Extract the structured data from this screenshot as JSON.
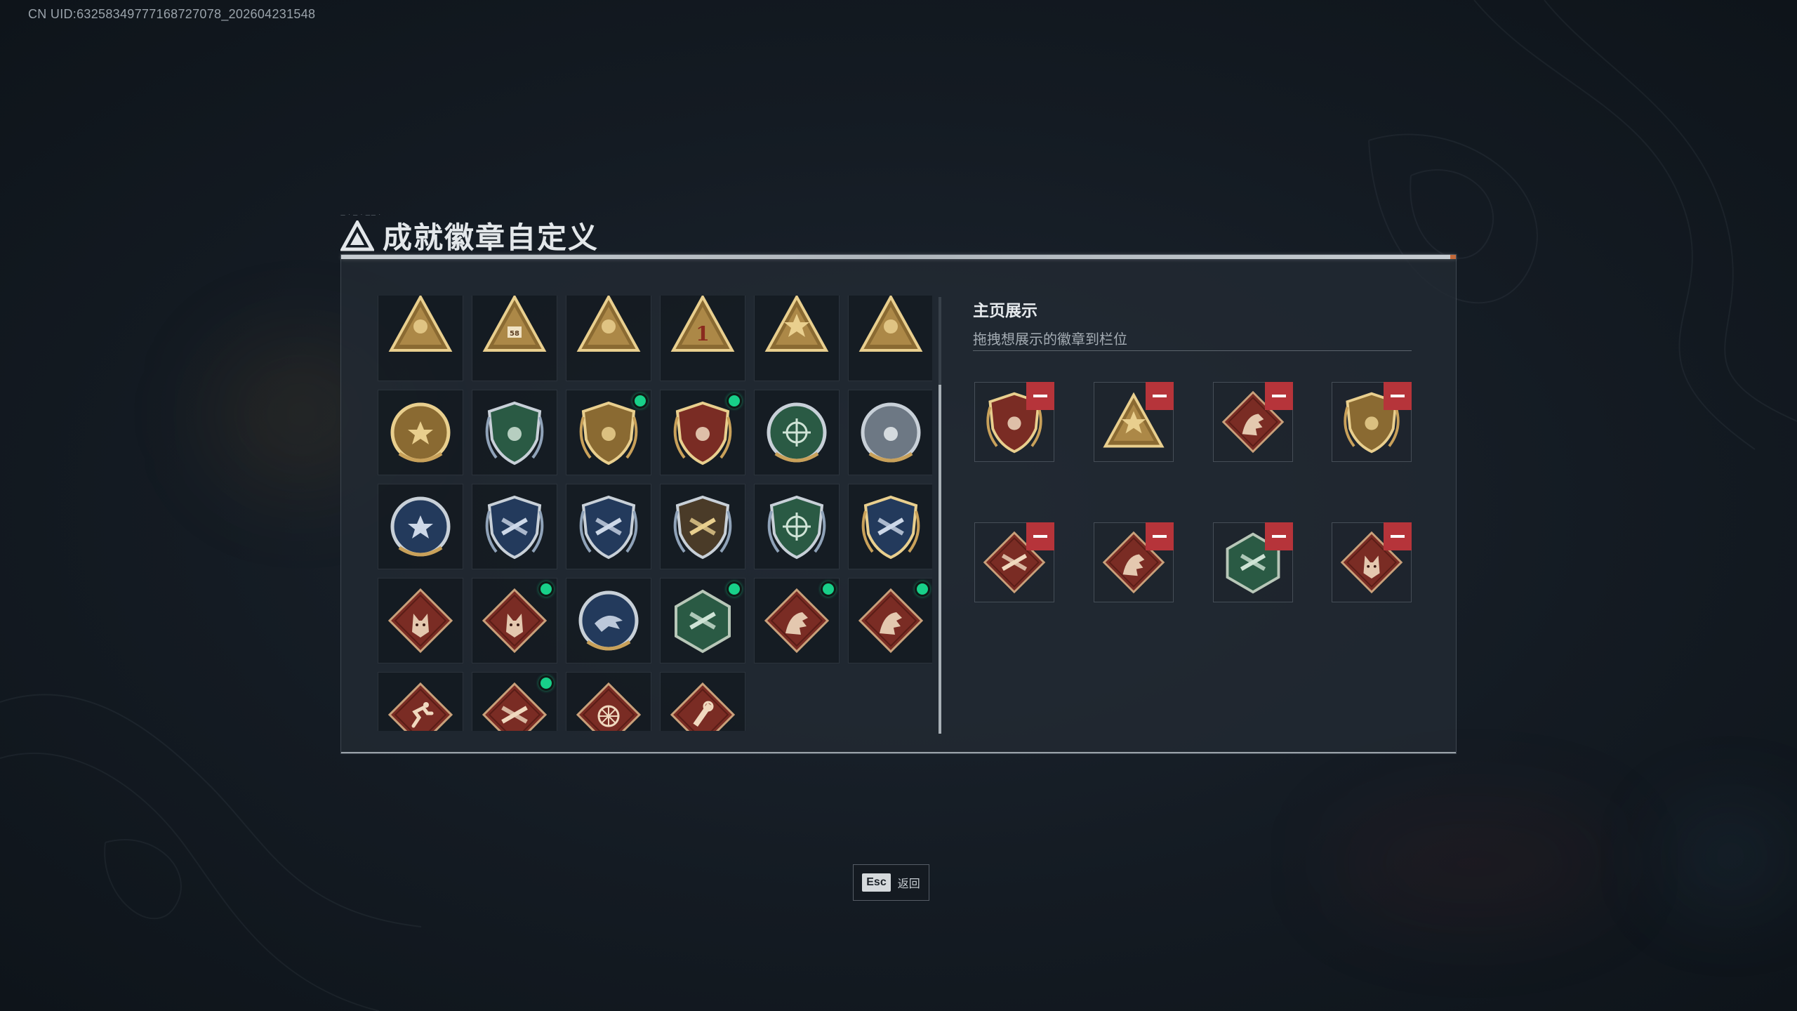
{
  "uid_text": "CN UID:63258349777168727078_202604231548",
  "title": "成就徽章自定义",
  "showcase": {
    "title": "主页展示",
    "hint": "拖拽想展示的徽章到栏位"
  },
  "esc": {
    "key": "Esc",
    "label": "返回"
  },
  "colors": {
    "accent_green": "#18d089",
    "remove_red": "#b6343a",
    "gold": "#c9a15a",
    "badge_red": "#7a2c24",
    "badge_green": "#2a5a44",
    "badge_navy": "#233a5c"
  },
  "badge_rows": [
    [
      {
        "icon": "gold-triangle-ruins-badge",
        "new": false
      },
      {
        "icon": "gold-triangle-58-badge",
        "new": false
      },
      {
        "icon": "gold-triangle-hand-badge",
        "new": false
      },
      {
        "icon": "gold-triangle-number-1-badge",
        "new": false
      },
      {
        "icon": "gold-triangle-star-badge",
        "new": false
      },
      {
        "icon": "gold-triangle-soldiers-badge",
        "new": false
      }
    ],
    [
      {
        "icon": "gold-star-medal-badge",
        "new": false
      },
      {
        "icon": "green-shield-badge",
        "new": false
      },
      {
        "icon": "gold-winged-shield-badge",
        "new": true
      },
      {
        "icon": "red-gold-winged-shield-badge",
        "new": true
      },
      {
        "icon": "green-skull-crosshair-badge",
        "new": false
      },
      {
        "icon": "silver-wreath-crest-badge",
        "new": false
      }
    ],
    [
      {
        "icon": "navy-star-burst-badge",
        "new": false
      },
      {
        "icon": "navy-rifle-wreath-badge",
        "new": false
      },
      {
        "icon": "navy-crossed-rifles-badge",
        "new": false
      },
      {
        "icon": "bronze-pistol-shield-badge",
        "new": false
      },
      {
        "icon": "green-crosshair-shield-badge",
        "new": false
      },
      {
        "icon": "gold-navy-rifles-shield-badge",
        "new": false
      }
    ],
    [
      {
        "icon": "red-diamond-wolf-badge",
        "new": false
      },
      {
        "icon": "red-diamond-wolf-badge",
        "new": true
      },
      {
        "icon": "navy-round-eagle-badge",
        "new": false
      },
      {
        "icon": "green-hexagon-gun-badge",
        "new": true
      },
      {
        "icon": "red-diamond-dragon-badge",
        "new": true
      },
      {
        "icon": "red-diamond-dragon-badge",
        "new": true
      }
    ],
    [
      {
        "icon": "red-diamond-runner-badge",
        "new": false
      },
      {
        "icon": "red-diamond-crossed-rifles-badge",
        "new": true
      },
      {
        "icon": "red-diamond-wheel-badge",
        "new": false
      },
      {
        "icon": "red-diamond-wrench-badge",
        "new": false
      }
    ]
  ],
  "showcase_slots": [
    {
      "icon": "red-gold-winged-shield-badge"
    },
    {
      "icon": "gold-triangle-star-badge"
    },
    {
      "icon": "red-diamond-dragon-badge"
    },
    {
      "icon": "gold-winged-shield-badge"
    },
    {
      "icon": "red-diamond-crossed-rifles-badge"
    },
    {
      "icon": "red-diamond-dragon-badge"
    },
    {
      "icon": "green-hexagon-gun-badge"
    },
    {
      "icon": "red-diamond-wolf-badge"
    }
  ]
}
